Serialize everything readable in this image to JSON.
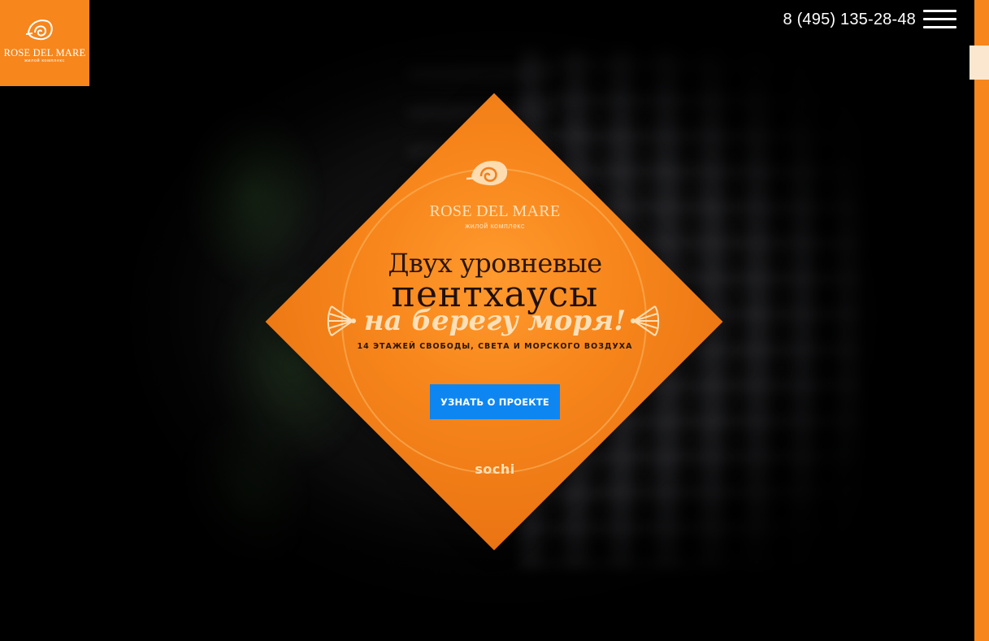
{
  "header": {
    "logo": {
      "brand": "ROSE DEL MARE",
      "subtitle": "жилой комплекс",
      "icon": "shell-logo-icon"
    },
    "phone": "8 (495) 135-28-48",
    "menu_icon": "hamburger-menu-icon"
  },
  "hero": {
    "logo": {
      "brand": "ROSE DEL MARE",
      "subtitle": "жилой комплекс",
      "icon": "shell-logo-icon"
    },
    "headline_line1": "Двух уровневые",
    "headline_line2": "пентхаусы",
    "headline_line3": "на берегу моря!",
    "tagline": "14 ЭТАЖЕЙ СВОБОДЫ, СВЕТА И МОРСКОГО ВОЗДУХА",
    "cta_label": "УЗНАТЬ О ПРОЕКТЕ",
    "location_mark": "sochi"
  },
  "colors": {
    "accent_orange": "#f7861c",
    "cta_blue": "#0d86f2",
    "cream_text": "#fde0b8",
    "dark_text": "#2a160a"
  }
}
